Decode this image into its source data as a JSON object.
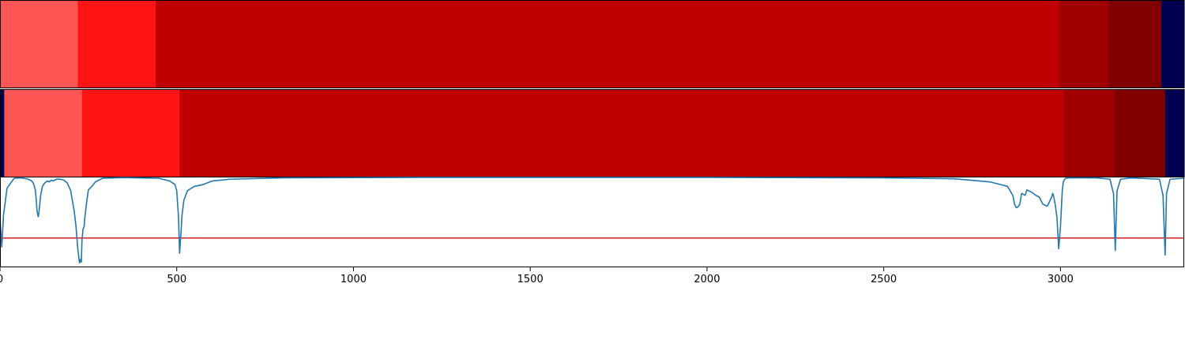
{
  "chart_data": {
    "type": "heatmap",
    "x_range": [
      0,
      3350
    ],
    "x_ticks": [
      0,
      500,
      1000,
      1500,
      2000,
      2500,
      3000
    ],
    "x_tick_labels": [
      "0",
      "500",
      "1000",
      "1500",
      "2000",
      "2500",
      "3000"
    ],
    "title": "",
    "xlabel": "",
    "ylabel": "",
    "grid": false,
    "color_bands": [
      {
        "segments": [
          {
            "start": 0,
            "end": 220,
            "color": "#ff5555"
          },
          {
            "start": 220,
            "end": 440,
            "color": "#ff1515"
          },
          {
            "start": 440,
            "end": 2995,
            "color": "#c00000"
          },
          {
            "start": 2995,
            "end": 3135,
            "color": "#a00000"
          },
          {
            "start": 3135,
            "end": 3285,
            "color": "#800000"
          },
          {
            "start": 3285,
            "end": 3350,
            "color": "#000050"
          }
        ]
      },
      {
        "segments": [
          {
            "start": 0,
            "end": 12,
            "color": "#000050"
          },
          {
            "start": 12,
            "end": 232,
            "color": "#ff5555"
          },
          {
            "start": 232,
            "end": 508,
            "color": "#ff1515"
          },
          {
            "start": 508,
            "end": 3010,
            "color": "#c00000"
          },
          {
            "start": 3010,
            "end": 3152,
            "color": "#a00000"
          },
          {
            "start": 3152,
            "end": 3296,
            "color": "#800000"
          },
          {
            "start": 3296,
            "end": 3350,
            "color": "#000050"
          }
        ]
      }
    ],
    "signal": {
      "color": "#1f77b4",
      "y_range": [
        0,
        1
      ],
      "x": [
        0,
        5,
        10,
        20,
        40,
        60,
        80,
        90,
        95,
        100,
        102,
        103,
        105,
        108,
        110,
        115,
        120,
        125,
        130,
        135,
        140,
        145,
        150,
        155,
        160,
        170,
        180,
        190,
        200,
        210,
        215,
        220,
        225,
        228,
        230,
        232,
        235,
        238,
        240,
        245,
        250,
        260,
        270,
        290,
        350,
        450,
        480,
        495,
        500,
        505,
        508,
        512,
        515,
        520,
        530,
        550,
        575,
        600,
        650,
        800,
        1200,
        2000,
        2500,
        2700,
        2800,
        2850,
        2865,
        2870,
        2875,
        2880,
        2885,
        2890,
        2900,
        2905,
        2910,
        2920,
        2930,
        2940,
        2950,
        2960,
        2963,
        2968,
        2975,
        2978,
        2980,
        2985,
        2990,
        2995,
        3000,
        3005,
        3008,
        3012,
        3015,
        3020,
        3030,
        3100,
        3140,
        3150,
        3155,
        3160,
        3170,
        3200,
        3280,
        3290,
        3296,
        3300,
        3310,
        3350
      ],
      "y": [
        0.55,
        0.22,
        0.58,
        0.88,
        0.99,
        0.995,
        0.98,
        0.96,
        0.93,
        0.86,
        0.77,
        0.72,
        0.62,
        0.56,
        0.6,
        0.8,
        0.9,
        0.93,
        0.95,
        0.96,
        0.95,
        0.97,
        0.96,
        0.97,
        0.98,
        0.98,
        0.97,
        0.94,
        0.85,
        0.62,
        0.45,
        0.2,
        0.04,
        0.08,
        0.05,
        0.3,
        0.42,
        0.45,
        0.55,
        0.72,
        0.86,
        0.9,
        0.95,
        0.99,
        0.998,
        0.99,
        0.96,
        0.92,
        0.85,
        0.55,
        0.15,
        0.38,
        0.58,
        0.74,
        0.85,
        0.9,
        0.92,
        0.96,
        0.98,
        0.995,
        1.0,
        1.0,
        0.995,
        0.985,
        0.95,
        0.9,
        0.8,
        0.7,
        0.66,
        0.67,
        0.7,
        0.82,
        0.8,
        0.86,
        0.85,
        0.83,
        0.8,
        0.78,
        0.7,
        0.68,
        0.68,
        0.72,
        0.78,
        0.82,
        0.8,
        0.7,
        0.55,
        0.2,
        0.45,
        0.85,
        0.95,
        0.98,
        0.99,
        0.995,
        0.995,
        0.995,
        0.98,
        0.82,
        0.18,
        0.85,
        0.98,
        0.995,
        0.98,
        0.8,
        0.13,
        0.82,
        0.98,
        0.99
      ]
    },
    "threshold": {
      "value": 0.32,
      "color": "#e31a1c"
    }
  }
}
